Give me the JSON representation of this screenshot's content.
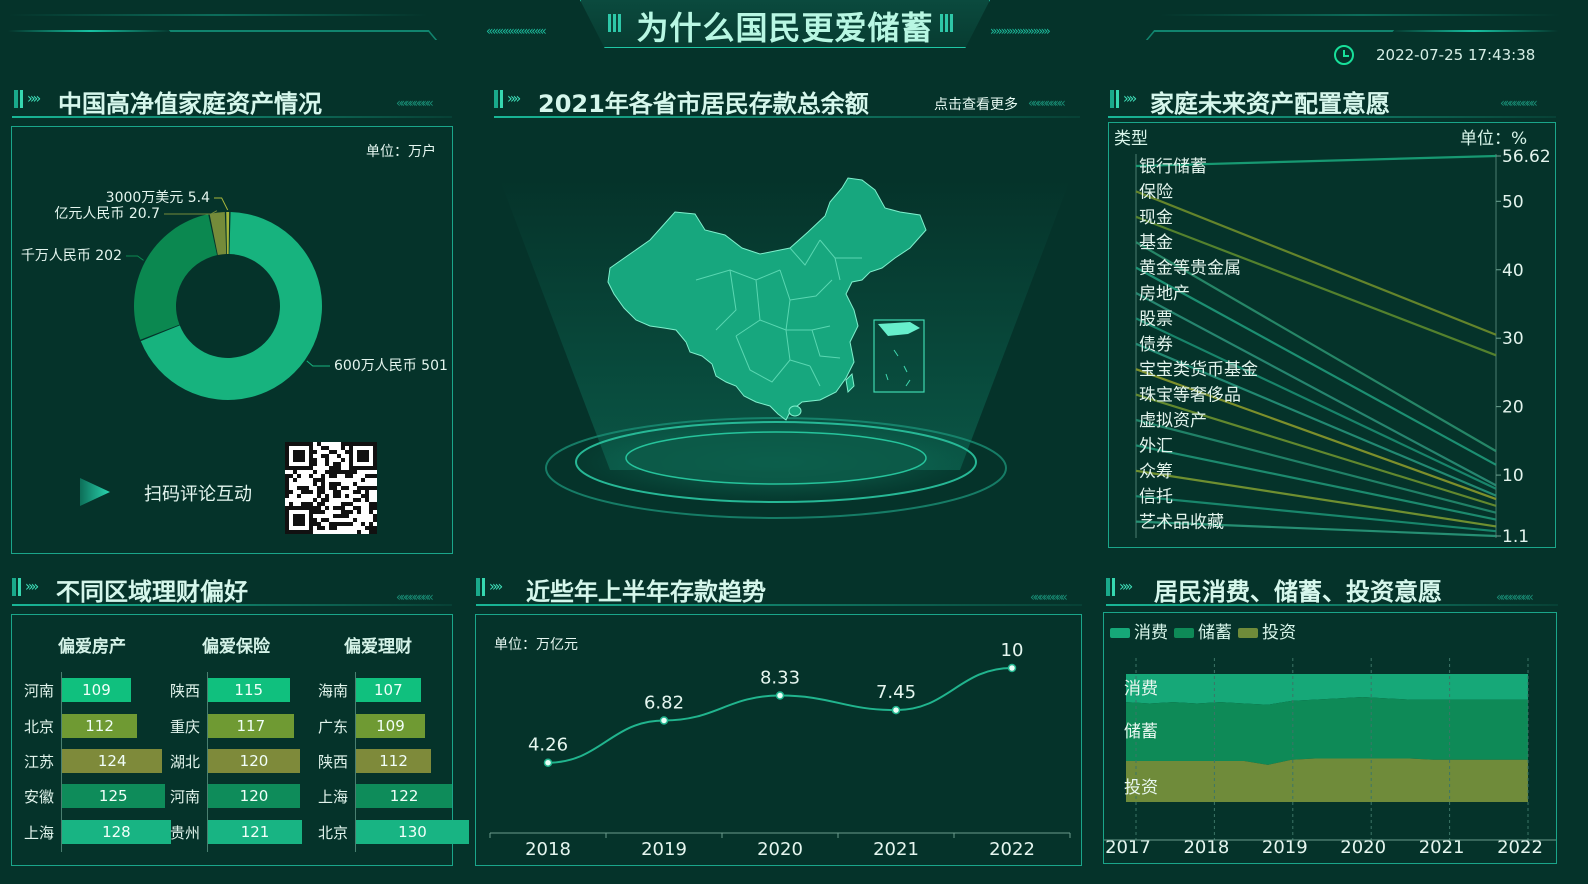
{
  "header": {
    "title": "为什么国民更爱储蓄",
    "datetime": "2022-07-25 17:43:38"
  },
  "panels": {
    "assets": {
      "title": "中国高净值家庭资产情况",
      "unit": "单位：万户",
      "qr_label": "扫码评论互动"
    },
    "map": {
      "title": "2021年各省市居民存款总余额",
      "more": "点击查看更多"
    },
    "allocation": {
      "title": "家庭未来资产配置意愿",
      "type_label": "类型",
      "unit": "单位：%"
    },
    "regions": {
      "title": "不同区域理财偏好"
    },
    "trend": {
      "title": "近些年上半年存款趋势",
      "unit": "单位：万亿元"
    },
    "intent": {
      "title": "居民消费、储蓄、投资意愿"
    }
  },
  "colors": {
    "background": "#05332a",
    "accent": "#1fc7a5",
    "green_bright": "#16b57f",
    "green_dark": "#0e8a57",
    "olive": "#6e8a3a"
  },
  "chart_data": [
    {
      "id": "donut",
      "type": "pie",
      "slices": [
        {
          "label": "600万人民币",
          "value": 501,
          "color": "#17b37e"
        },
        {
          "label": "千万人民币",
          "value": 202,
          "color": "#0b8850"
        },
        {
          "label": "亿元人民币",
          "value": 20.7,
          "color": "#758b3a"
        },
        {
          "label": "3000万美元",
          "value": 5.4,
          "color": "#a7b53c"
        }
      ],
      "labels": [
        {
          "text": "600万人民币 501"
        },
        {
          "text": "千万人民币 202"
        },
        {
          "text": "亿元人民币 20.7"
        },
        {
          "text": "3000万美元 5.4"
        }
      ]
    },
    {
      "id": "slope",
      "type": "line",
      "categories": [
        "银行储蓄",
        "保险",
        "现金",
        "基金",
        "黄金等贵金属",
        "房地产",
        "股票",
        "债券",
        "宝宝类货币基金",
        "珠宝等奢侈品",
        "虚拟资产",
        "外汇",
        "众筹",
        "信托",
        "艺术品收藏"
      ],
      "values": [
        56.62,
        30.5,
        27.5,
        13.5,
        11.5,
        8.5,
        8.0,
        7.0,
        6.5,
        5.5,
        4.5,
        3.5,
        2.5,
        1.8,
        1.1
      ],
      "y_ticks": [
        "56.62",
        "50",
        "40",
        "30",
        "20",
        "10",
        "1.1"
      ],
      "ylim": [
        1.1,
        56.62
      ]
    },
    {
      "id": "regions",
      "type": "bar",
      "groups": [
        {
          "name": "偏爱房产",
          "items": [
            {
              "label": "河南",
              "value": 109
            },
            {
              "label": "北京",
              "value": 112
            },
            {
              "label": "江苏",
              "value": 124
            },
            {
              "label": "安徽",
              "value": 125
            },
            {
              "label": "上海",
              "value": 128
            }
          ]
        },
        {
          "name": "偏爱保险",
          "items": [
            {
              "label": "陕西",
              "value": 115
            },
            {
              "label": "重庆",
              "value": 117
            },
            {
              "label": "湖北",
              "value": 120
            },
            {
              "label": "河南",
              "value": 120
            },
            {
              "label": "贵州",
              "value": 121
            }
          ]
        },
        {
          "name": "偏爱理财",
          "items": [
            {
              "label": "海南",
              "value": 107
            },
            {
              "label": "广东",
              "value": 109
            },
            {
              "label": "陕西",
              "value": 112
            },
            {
              "label": "上海",
              "value": 122
            },
            {
              "label": "北京",
              "value": 130
            }
          ]
        }
      ]
    },
    {
      "id": "trend",
      "type": "line",
      "categories": [
        "2018",
        "2019",
        "2020",
        "2021",
        "2022"
      ],
      "values": [
        4.26,
        6.82,
        8.33,
        7.45,
        10
      ],
      "value_labels": [
        "4.26",
        "6.82",
        "8.33",
        "7.45",
        "10"
      ],
      "ylim": [
        0,
        12
      ]
    },
    {
      "id": "intent",
      "type": "area",
      "x_ticks": [
        "2017",
        "2018",
        "2019",
        "2020",
        "2021",
        "2022"
      ],
      "legend": [
        "消费",
        "储蓄",
        "投资"
      ],
      "area_labels": [
        "消费",
        "储蓄",
        "投资"
      ],
      "series": [
        {
          "name": "消费",
          "color": "#16a878",
          "values": [
            22,
            23,
            22,
            23,
            22,
            23,
            24,
            21,
            20,
            19,
            18,
            19,
            20,
            20,
            20,
            20,
            20,
            20
          ]
        },
        {
          "name": "储蓄",
          "color": "#0e8a57",
          "values": [
            46,
            45,
            46,
            45,
            46,
            45,
            47,
            46,
            46,
            47,
            48,
            47,
            46,
            47,
            47,
            47,
            47,
            47
          ]
        },
        {
          "name": "投资",
          "color": "#6f8b3a",
          "values": [
            32,
            32,
            32,
            32,
            32,
            32,
            29,
            33,
            34,
            34,
            34,
            34,
            34,
            33,
            33,
            33,
            33,
            33
          ]
        }
      ]
    }
  ]
}
